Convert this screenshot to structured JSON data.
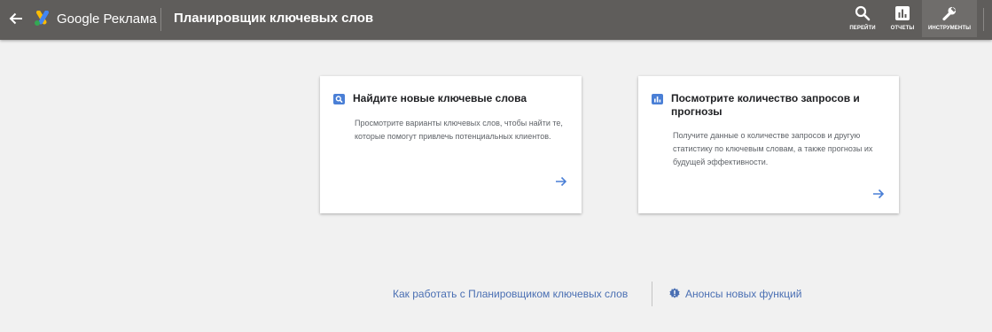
{
  "app": {
    "brand": "Google Реклама",
    "page_title": "Планировщик ключевых слов"
  },
  "toolbar": {
    "items": [
      {
        "label": "ПЕРЕЙТИ",
        "icon": "search-icon"
      },
      {
        "label": "ОТЧЕТЫ",
        "icon": "bar-chart-icon"
      },
      {
        "label": "ИНСТРУМЕНТЫ",
        "icon": "wrench-icon",
        "active": true
      }
    ]
  },
  "cards": [
    {
      "icon": "search-icon",
      "title": "Найдите новые ключевые слова",
      "description": "Просмотрите варианты ключевых слов, чтобы найти те, которые помогут привлечь потенциальных клиентов."
    },
    {
      "icon": "bar-chart-icon",
      "title": "Посмотрите количество запросов и прогнозы",
      "description": "Получите данные о количестве запросов и другую статистику по ключевым словам, а также прогнозы их будущей эффективности."
    }
  ],
  "footer": {
    "how_to_link": "Как работать с Планировщиком ключевых слов",
    "announcements_link": "Анонсы новых функций"
  },
  "colors": {
    "topbar": "#5f5d5b",
    "accent_blue": "#4a7fd6",
    "link": "#4a6fb3",
    "background": "#f1f1f1"
  }
}
